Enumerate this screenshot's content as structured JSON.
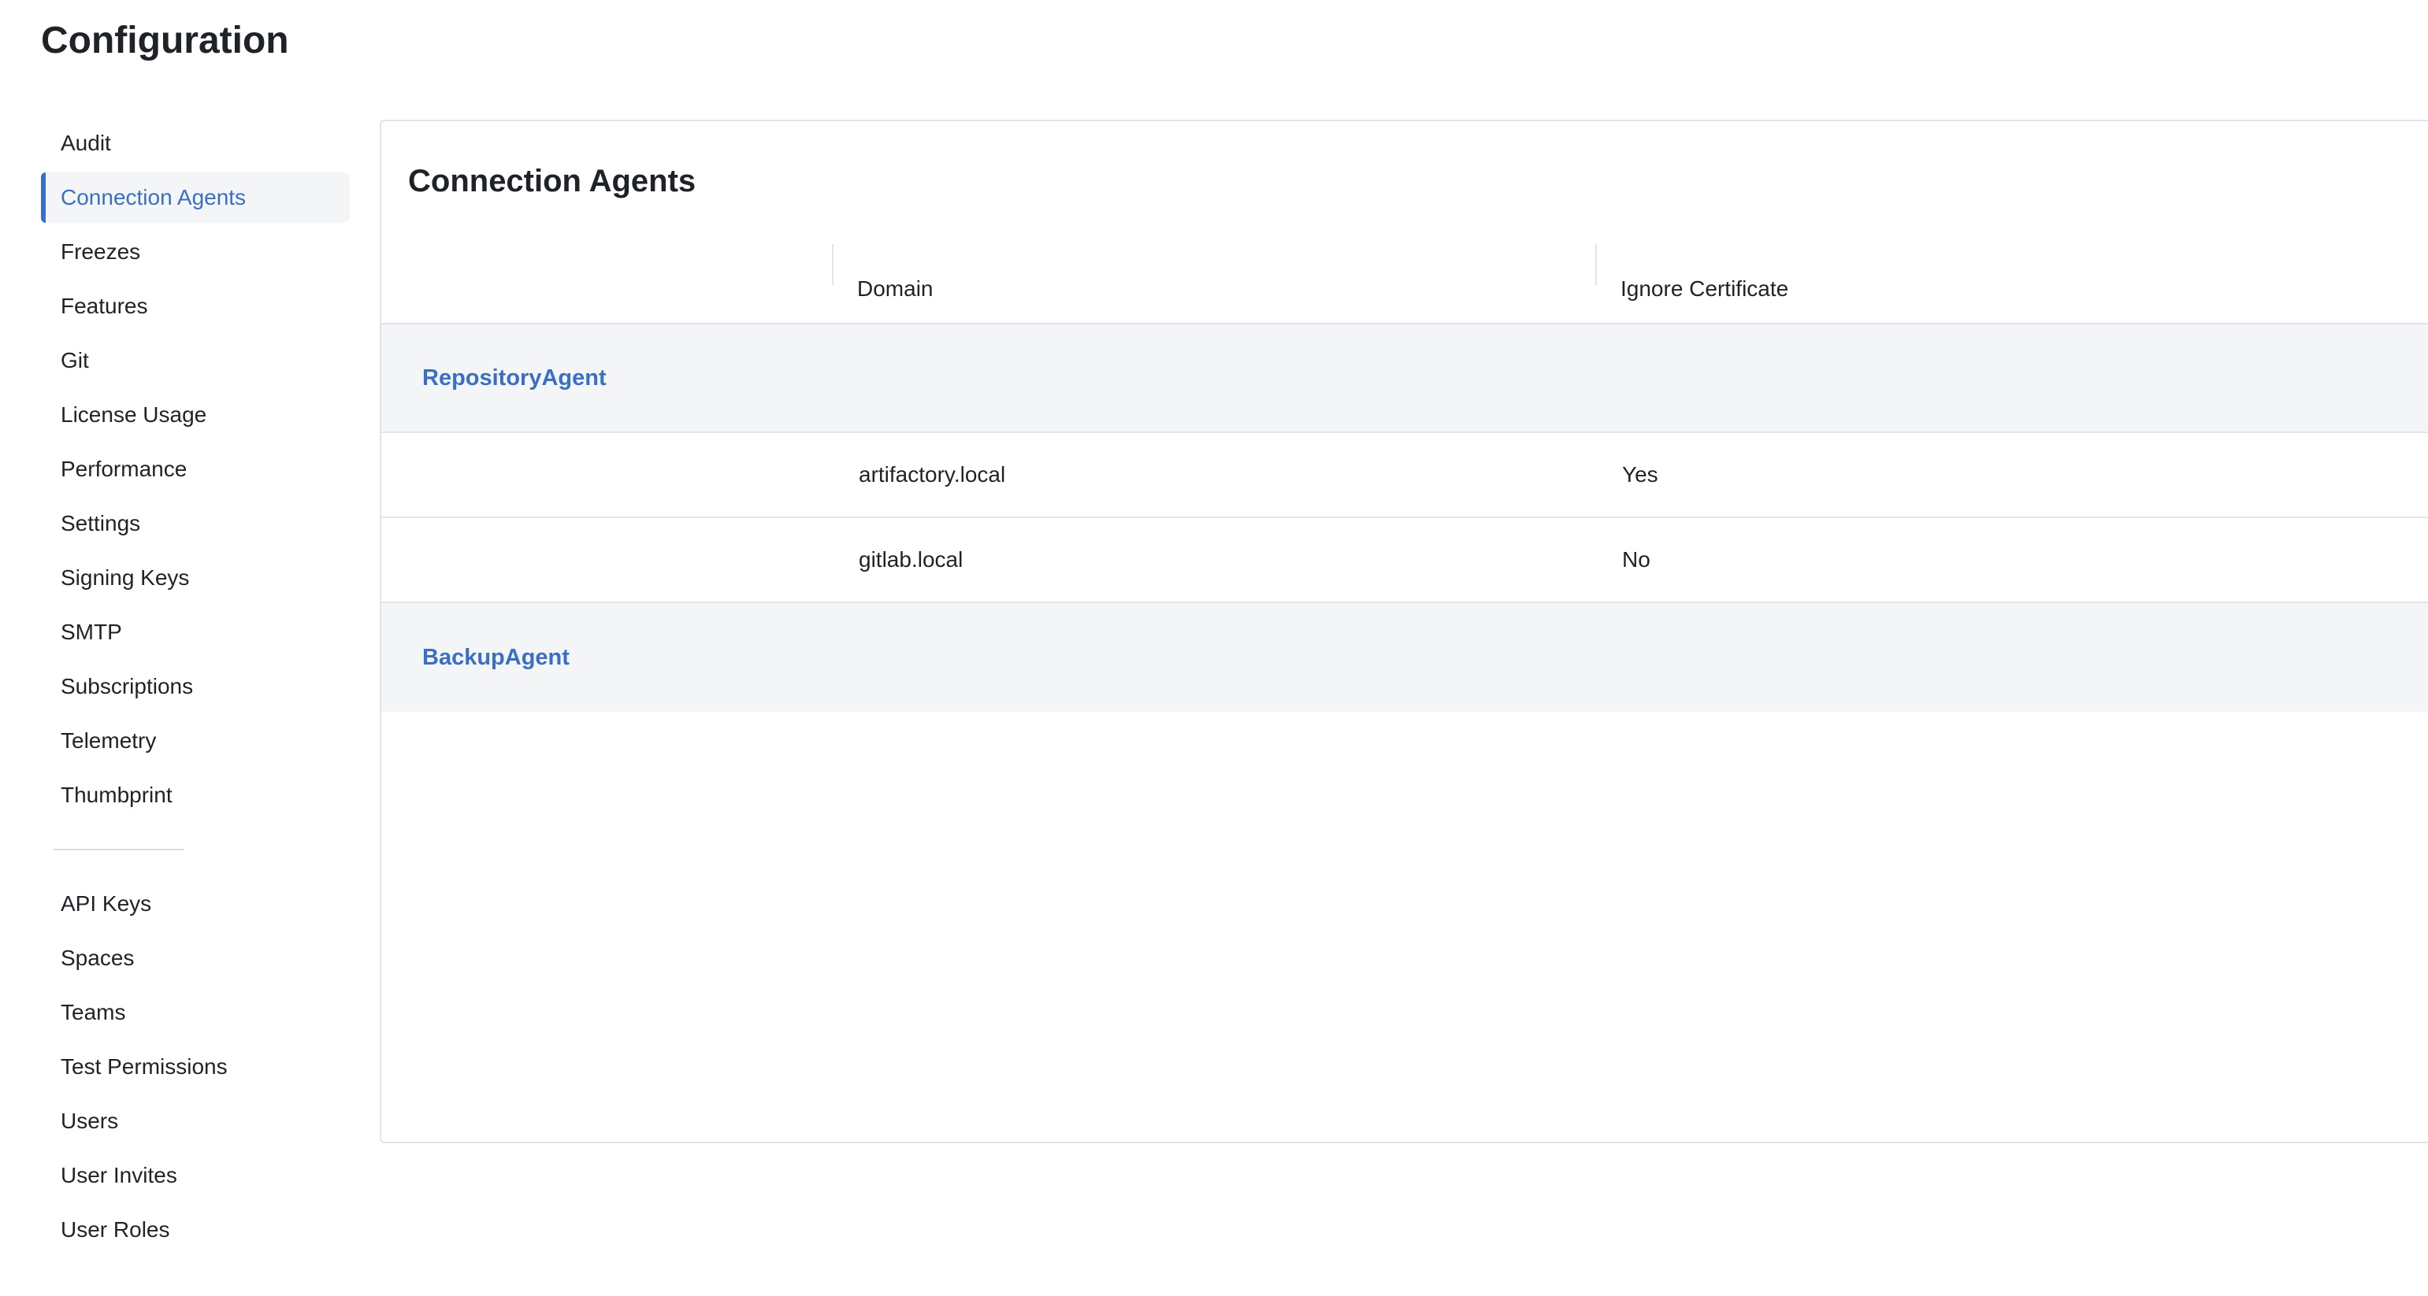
{
  "page": {
    "title": "Configuration"
  },
  "sidebar": {
    "primary": [
      {
        "label": "Audit",
        "active": false
      },
      {
        "label": "Connection Agents",
        "active": true
      },
      {
        "label": "Freezes",
        "active": false
      },
      {
        "label": "Features",
        "active": false
      },
      {
        "label": "Git",
        "active": false
      },
      {
        "label": "License Usage",
        "active": false
      },
      {
        "label": "Performance",
        "active": false
      },
      {
        "label": "Settings",
        "active": false
      },
      {
        "label": "Signing Keys",
        "active": false
      },
      {
        "label": "SMTP",
        "active": false
      },
      {
        "label": "Subscriptions",
        "active": false
      },
      {
        "label": "Telemetry",
        "active": false
      },
      {
        "label": "Thumbprint",
        "active": false
      }
    ],
    "secondary": [
      {
        "label": "API Keys",
        "active": false
      },
      {
        "label": "Spaces",
        "active": false
      },
      {
        "label": "Teams",
        "active": false
      },
      {
        "label": "Test Permissions",
        "active": false
      },
      {
        "label": "Users",
        "active": false
      },
      {
        "label": "User Invites",
        "active": false
      },
      {
        "label": "User Roles",
        "active": false
      }
    ]
  },
  "panel": {
    "title": "Connection Agents",
    "columns": [
      "",
      "Domain",
      "Ignore Certificate"
    ],
    "groups": [
      {
        "name": "RepositoryAgent",
        "rows": [
          {
            "domain": "artifactory.local",
            "ignore_certificate": "Yes"
          },
          {
            "domain": "gitlab.local",
            "ignore_certificate": "No"
          }
        ]
      },
      {
        "name": "BackupAgent",
        "rows": []
      }
    ]
  },
  "colors": {
    "accent": "#3b6fc2",
    "active_bg": "#f3f5f7",
    "border": "#e1e4e8",
    "text": "#1f2328"
  }
}
